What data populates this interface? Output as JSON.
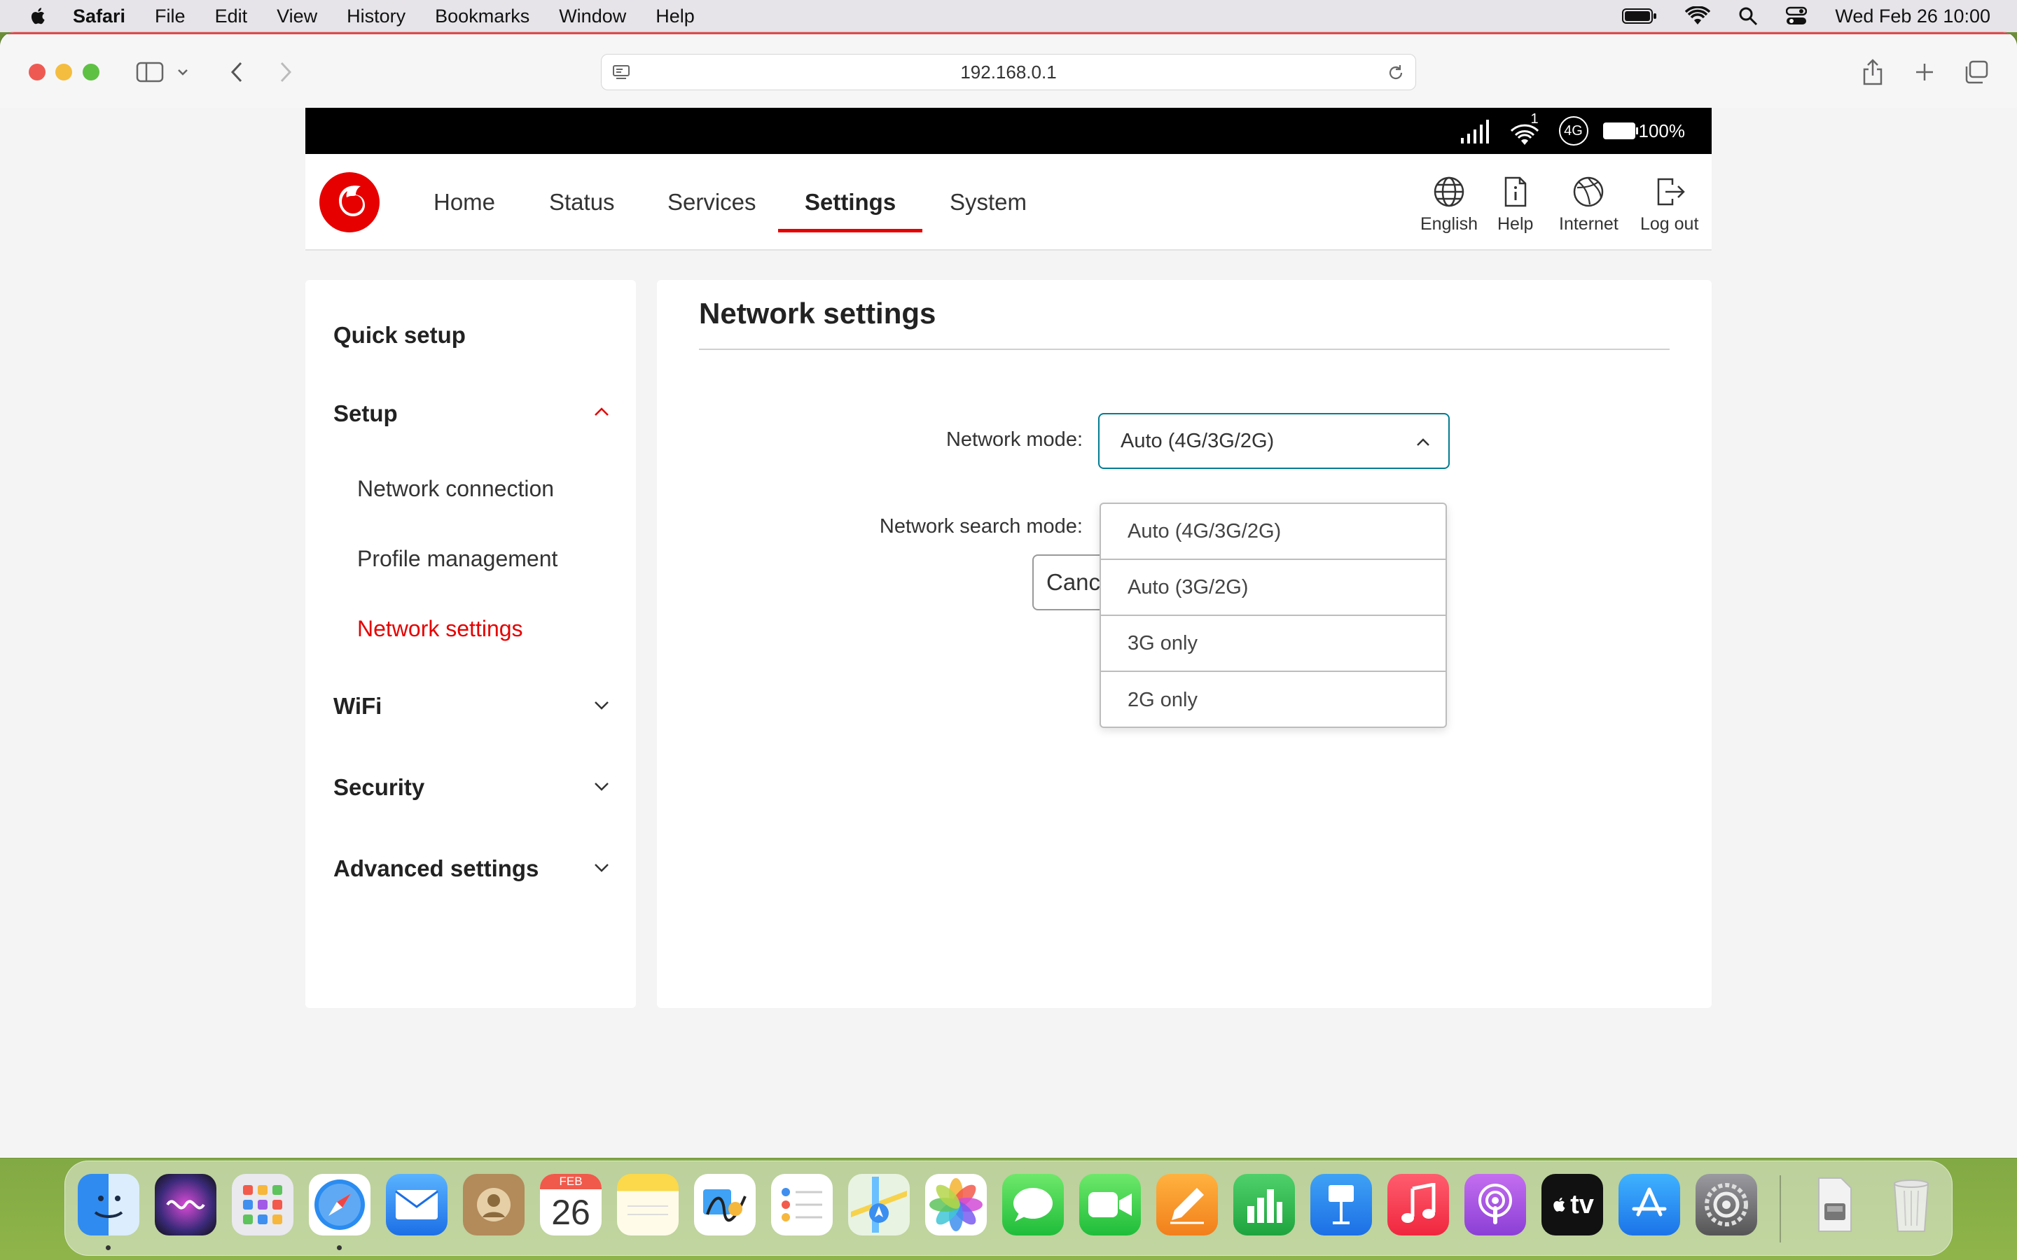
{
  "menubar": {
    "app": "Safari",
    "items": [
      "File",
      "Edit",
      "View",
      "History",
      "Bookmarks",
      "Window",
      "Help"
    ],
    "clock": "Wed Feb 26  10:00"
  },
  "browser": {
    "url": "192.168.0.1"
  },
  "router_status": {
    "network_type": "4G",
    "wifi_clients": "1",
    "battery": "100%"
  },
  "topnav": {
    "tabs": [
      "Home",
      "Status",
      "Services",
      "Settings",
      "System"
    ],
    "active_tab": "Settings",
    "utilities": [
      "English",
      "Help",
      "Internet",
      "Log out"
    ]
  },
  "sidebar": {
    "quick_setup": "Quick setup",
    "setup": "Setup",
    "setup_children": [
      "Network connection",
      "Profile management",
      "Network settings"
    ],
    "active_child": "Network settings",
    "wifi": "WiFi",
    "security": "Security",
    "advanced": "Advanced settings"
  },
  "main": {
    "title": "Network settings",
    "network_mode_label": "Network mode:",
    "network_mode_value": "Auto (4G/3G/2G)",
    "network_search_label": "Network search mode:",
    "cancel_label": "Cancel",
    "dropdown_options": [
      "Auto (4G/3G/2G)",
      "Auto (3G/2G)",
      "3G only",
      "2G only"
    ]
  },
  "dock": {
    "calendar_month": "FEB",
    "calendar_day": "26",
    "tv_label": "tv"
  },
  "colors": {
    "vodafone_red": "#e60000",
    "focus_teal": "#007c92"
  }
}
